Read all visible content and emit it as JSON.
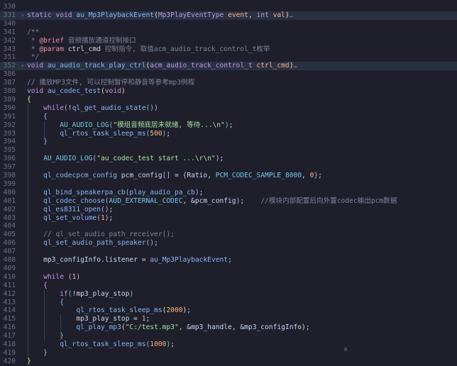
{
  "lines": [
    {
      "n": "330",
      "tokens": []
    },
    {
      "n": "331",
      "fold": "›",
      "hl": true,
      "tokens": [
        [
          "kw",
          "static "
        ],
        [
          "ty",
          "void "
        ],
        [
          "fn",
          "au_Mp3PlaybackEvent"
        ],
        [
          "b1",
          "("
        ],
        [
          "ty",
          "Mp3PlayEventType "
        ],
        [
          "pm",
          "event"
        ],
        [
          "p",
          ", "
        ],
        [
          "ty",
          "int "
        ],
        [
          "pm",
          "val"
        ],
        [
          "b1",
          ")"
        ],
        [
          "cm",
          "…"
        ]
      ]
    },
    {
      "n": "340",
      "tokens": []
    },
    {
      "n": "341",
      "tokens": [
        [
          "cm",
          "/**"
        ]
      ]
    },
    {
      "n": "342",
      "tokens": [
        [
          "cm",
          " * "
        ],
        [
          "doc",
          "@brief"
        ],
        [
          "cm",
          " 音频播放通道控制接口"
        ]
      ]
    },
    {
      "n": "343",
      "tokens": [
        [
          "cm",
          " * "
        ],
        [
          "doc",
          "@param"
        ],
        [
          "cm",
          " "
        ],
        [
          "var",
          "ctrl_cmd"
        ],
        [
          "cm",
          " 控制指令, 取值acm_audio_track_control_t枚举"
        ]
      ]
    },
    {
      "n": "351",
      "tokens": [
        [
          "cm",
          " */"
        ]
      ]
    },
    {
      "n": "352",
      "fold": "›",
      "hl": true,
      "tokens": [
        [
          "ty",
          "void "
        ],
        [
          "fn",
          "au_audio_track_play_ctrl"
        ],
        [
          "b1",
          "("
        ],
        [
          "ty",
          "acm_audio_track_control_t "
        ],
        [
          "pm",
          "ctrl_cmd"
        ],
        [
          "b1",
          ")"
        ],
        [
          "cm",
          "…"
        ]
      ]
    },
    {
      "n": "386",
      "tokens": []
    },
    {
      "n": "387",
      "tokens": [
        [
          "cm",
          "// 播放MP3文件, 可以控制暂停和静音等参考mp3例程"
        ]
      ]
    },
    {
      "n": "388",
      "tokens": [
        [
          "ty",
          "void "
        ],
        [
          "fn",
          "au_codec_test"
        ],
        [
          "b1",
          "("
        ],
        [
          "ty",
          "void"
        ],
        [
          "b1",
          ")"
        ]
      ]
    },
    {
      "n": "389",
      "tokens": [
        [
          "b1",
          "{"
        ]
      ]
    },
    {
      "n": "390",
      "tokens": [
        [
          "p",
          "    "
        ],
        [
          "kw",
          "while"
        ],
        [
          "b2",
          "("
        ],
        [
          "p",
          "!"
        ],
        [
          "fn",
          "ql_get_audio_state"
        ],
        [
          "b3",
          "()"
        ],
        [
          "b2",
          ")"
        ]
      ]
    },
    {
      "n": "391",
      "tokens": [
        [
          "p",
          "    "
        ],
        [
          "b2",
          "{"
        ]
      ]
    },
    {
      "n": "392",
      "tokens": [
        [
          "p",
          "        "
        ],
        [
          "mac",
          "AU_AUDIO_LOG"
        ],
        [
          "b3",
          "("
        ],
        [
          "str",
          "\"模组音频底层未就绪, 等待...\\n\""
        ],
        [
          "b3",
          ")"
        ],
        [
          "p",
          ";"
        ]
      ]
    },
    {
      "n": "393",
      "tokens": [
        [
          "p",
          "        "
        ],
        [
          "fn",
          "ql_rtos_task_sleep_ms"
        ],
        [
          "b3",
          "("
        ],
        [
          "num",
          "500"
        ],
        [
          "b3",
          ")"
        ],
        [
          "p",
          ";"
        ]
      ]
    },
    {
      "n": "394",
      "tokens": [
        [
          "p",
          "    "
        ],
        [
          "b2",
          "}"
        ]
      ]
    },
    {
      "n": "395",
      "tokens": []
    },
    {
      "n": "396",
      "tokens": [
        [
          "p",
          "    "
        ],
        [
          "mac",
          "AU_AUDIO_LOG"
        ],
        [
          "b2",
          "("
        ],
        [
          "str",
          "\"au_codec_test start ...\\r\\n\""
        ],
        [
          "b2",
          ")"
        ],
        [
          "p",
          ";"
        ]
      ]
    },
    {
      "n": "397",
      "tokens": []
    },
    {
      "n": "398",
      "tokens": [
        [
          "p",
          "    "
        ],
        [
          "st",
          "ql_codecpcm_config "
        ],
        [
          "var",
          "pcm_config"
        ],
        [
          "b2",
          "[]"
        ],
        [
          "p",
          " = "
        ],
        [
          "b2",
          "{"
        ],
        [
          "var",
          "Ratio"
        ],
        [
          "p",
          ", "
        ],
        [
          "mac",
          "PCM_CODEC_SAMPLE_8000"
        ],
        [
          "p",
          ", "
        ],
        [
          "num",
          "0"
        ],
        [
          "b2",
          "}"
        ],
        [
          "p",
          ";"
        ]
      ]
    },
    {
      "n": "399",
      "tokens": []
    },
    {
      "n": "400",
      "tokens": [
        [
          "p",
          "    "
        ],
        [
          "fn",
          "ql_bind_speakerpa_cb"
        ],
        [
          "b2",
          "("
        ],
        [
          "fn",
          "play_audio_pa_cb"
        ],
        [
          "b2",
          ")"
        ],
        [
          "p",
          ";"
        ]
      ]
    },
    {
      "n": "401",
      "tokens": [
        [
          "p",
          "    "
        ],
        [
          "fn",
          "ql_codec_choose"
        ],
        [
          "b2",
          "("
        ],
        [
          "mac",
          "AUD_EXTERNAL_CODEC"
        ],
        [
          "p",
          ", &"
        ],
        [
          "var",
          "pcm_config"
        ],
        [
          "b2",
          ")"
        ],
        [
          "p",
          ";    "
        ],
        [
          "cm",
          "//模块内部配置后向外置codec输出pcm数据"
        ]
      ]
    },
    {
      "n": "402",
      "tokens": [
        [
          "p",
          "    "
        ],
        [
          "fn",
          "ql_es8311_open"
        ],
        [
          "b2",
          "()"
        ],
        [
          "p",
          ";"
        ]
      ]
    },
    {
      "n": "403",
      "tokens": [
        [
          "p",
          "    "
        ],
        [
          "fn",
          "ql_set_volume"
        ],
        [
          "b2",
          "("
        ],
        [
          "num",
          "1"
        ],
        [
          "b2",
          ")"
        ],
        [
          "p",
          ";"
        ]
      ]
    },
    {
      "n": "404",
      "tokens": []
    },
    {
      "n": "405",
      "tokens": [
        [
          "p",
          "    "
        ],
        [
          "cm",
          "// ql_set_audio_path_receiver();"
        ]
      ]
    },
    {
      "n": "406",
      "tokens": [
        [
          "p",
          "    "
        ],
        [
          "fn",
          "ql_set_audio_path_speaker"
        ],
        [
          "b2",
          "()"
        ],
        [
          "p",
          ";"
        ]
      ]
    },
    {
      "n": "407",
      "tokens": []
    },
    {
      "n": "408",
      "tokens": [
        [
          "p",
          "    "
        ],
        [
          "var",
          "mp3_configInfo"
        ],
        [
          "p",
          "."
        ],
        [
          "var",
          "listener"
        ],
        [
          "p",
          " = "
        ],
        [
          "fn",
          "au_Mp3PlaybackEvent"
        ],
        [
          "p",
          ";"
        ]
      ]
    },
    {
      "n": "409",
      "tokens": []
    },
    {
      "n": "410",
      "tokens": [
        [
          "p",
          "    "
        ],
        [
          "kw",
          "while "
        ],
        [
          "b2",
          "("
        ],
        [
          "num",
          "1"
        ],
        [
          "b2",
          ")"
        ]
      ]
    },
    {
      "n": "411",
      "tokens": [
        [
          "p",
          "    "
        ],
        [
          "b2",
          "{"
        ]
      ]
    },
    {
      "n": "412",
      "tokens": [
        [
          "p",
          "        "
        ],
        [
          "kw",
          "if"
        ],
        [
          "b3",
          "("
        ],
        [
          "p",
          "!"
        ],
        [
          "var",
          "mp3_play_stop"
        ],
        [
          "b3",
          ")"
        ]
      ]
    },
    {
      "n": "413",
      "tokens": [
        [
          "p",
          "        "
        ],
        [
          "b3",
          "{"
        ]
      ]
    },
    {
      "n": "414",
      "tokens": [
        [
          "p",
          "            "
        ],
        [
          "fn",
          "ql_rtos_task_sleep_ms"
        ],
        [
          "b1",
          "("
        ],
        [
          "num",
          "2000"
        ],
        [
          "b1",
          ")"
        ],
        [
          "p",
          ";"
        ]
      ]
    },
    {
      "n": "415",
      "tokens": [
        [
          "p",
          "            "
        ],
        [
          "var",
          "mp3_play_stop"
        ],
        [
          "p",
          " = "
        ],
        [
          "num",
          "1"
        ],
        [
          "p",
          ";"
        ]
      ]
    },
    {
      "n": "416",
      "tokens": [
        [
          "p",
          "            "
        ],
        [
          "fn",
          "ql_play_mp3"
        ],
        [
          "b1",
          "("
        ],
        [
          "str",
          "\"C:/test.mp3\""
        ],
        [
          "p",
          ", &"
        ],
        [
          "var",
          "mp3_handle"
        ],
        [
          "p",
          ", &"
        ],
        [
          "var",
          "mp3_configInfo"
        ],
        [
          "b1",
          ")"
        ],
        [
          "p",
          ";"
        ]
      ]
    },
    {
      "n": "417",
      "tokens": [
        [
          "p",
          "        "
        ],
        [
          "b3",
          "}"
        ]
      ]
    },
    {
      "n": "418",
      "tokens": [
        [
          "p",
          "        "
        ],
        [
          "fn",
          "ql_rtos_task_sleep_ms"
        ],
        [
          "b3",
          "("
        ],
        [
          "num",
          "1000"
        ],
        [
          "b3",
          ")"
        ],
        [
          "p",
          ";"
        ]
      ]
    },
    {
      "n": "419",
      "tokens": [
        [
          "p",
          "    "
        ],
        [
          "b2",
          "}"
        ]
      ]
    },
    {
      "n": "420",
      "tokens": [
        [
          "b1",
          "}"
        ]
      ]
    }
  ]
}
